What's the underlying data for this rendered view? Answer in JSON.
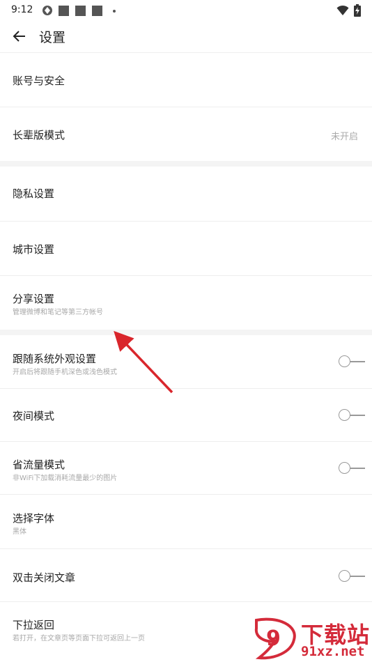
{
  "status_bar": {
    "time": "9:12",
    "icons": [
      "sync-icon",
      "notification-square-icon",
      "notification-square-icon",
      "notification-square-icon",
      "more-dot-icon",
      "wifi-icon",
      "battery-charging-icon"
    ]
  },
  "app_bar": {
    "back_icon": "arrow-left-icon",
    "title": "设置"
  },
  "settings": {
    "account": {
      "title": "账号与安全"
    },
    "elder_mode": {
      "title": "长辈版模式",
      "value": "未开启"
    },
    "privacy": {
      "title": "隐私设置"
    },
    "city": {
      "title": "城市设置"
    },
    "share": {
      "title": "分享设置",
      "subtitle": "管理微博和笔记等第三方帐号"
    },
    "follow_system": {
      "title": "跟随系统外观设置",
      "subtitle": "开启后将跟随手机深色或浅色模式",
      "toggle": false
    },
    "night_mode": {
      "title": "夜间模式",
      "toggle": false
    },
    "data_saver": {
      "title": "省流量模式",
      "subtitle": "非WiFi下加载消耗流量最少的图片",
      "toggle": false
    },
    "font": {
      "title": "选择字体",
      "subtitle": "黑体"
    },
    "double_tap_close": {
      "title": "双击关闭文章",
      "toggle": false
    },
    "pull_back": {
      "title": "下拉返回",
      "subtitle": "若打开，在文章页等页面下拉可返回上一页"
    }
  },
  "annotation": {
    "color": "#d9262c"
  },
  "watermark": {
    "text_cn": "下载站",
    "url": "91xz.net",
    "logo_text": "9",
    "color": "#d42b3a"
  }
}
